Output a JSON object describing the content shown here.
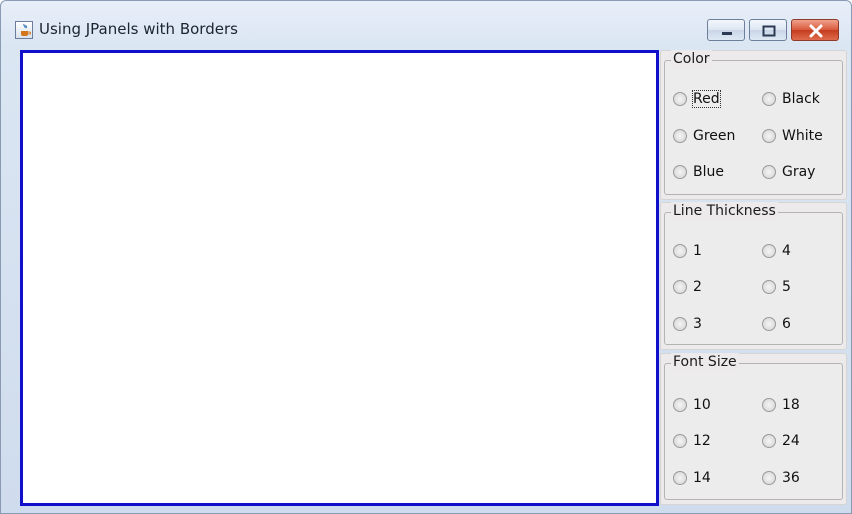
{
  "window": {
    "title": "Using JPanels with Borders"
  },
  "groups": {
    "color": {
      "title": "Color",
      "options": [
        "Red",
        "Black",
        "Green",
        "White",
        "Blue",
        "Gray"
      ]
    },
    "thickness": {
      "title": "Line Thickness",
      "options": [
        "1",
        "4",
        "2",
        "5",
        "3",
        "6"
      ]
    },
    "font_size": {
      "title": "Font Size",
      "options": [
        "10",
        "18",
        "12",
        "24",
        "14",
        "36"
      ]
    }
  }
}
